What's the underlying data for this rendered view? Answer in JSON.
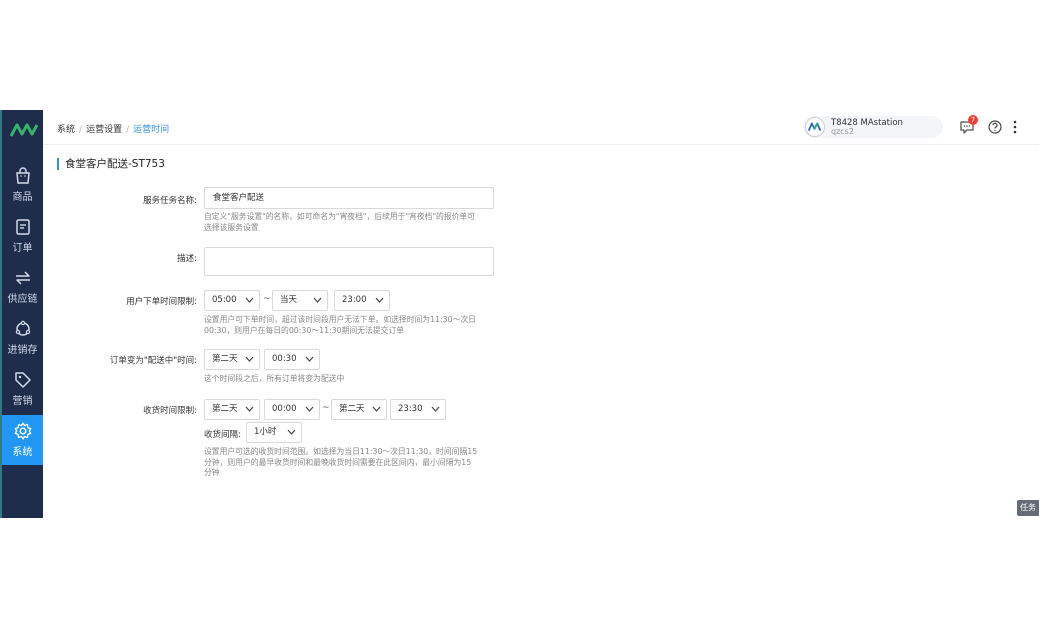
{
  "sidebar": {
    "items": [
      {
        "label": "商品",
        "icon": "shopping-bag-icon"
      },
      {
        "label": "订单",
        "icon": "document-icon"
      },
      {
        "label": "供应链",
        "icon": "swap-arrows-icon"
      },
      {
        "label": "进销存",
        "icon": "cycle-icon"
      },
      {
        "label": "营销",
        "icon": "tag-icon"
      },
      {
        "label": "系统",
        "icon": "gear-icon"
      }
    ],
    "active": "系统",
    "accent": "#2196f3",
    "background": "#1f2d4d"
  },
  "breadcrumb": {
    "items": [
      "系统",
      "运营设置",
      "运营时间"
    ]
  },
  "user": {
    "name": "T8428 MAstation",
    "account": "qzcs2"
  },
  "notifications": {
    "count": "7"
  },
  "section_title": "食堂客户配送-ST753",
  "form": {
    "service_name": {
      "label": "服务任务名称:",
      "value": "食堂客户配送",
      "hint": "自定义\"服务设置\"的名称，如可命名为\"宵夜档\"，后续用于\"宵夜档\"的报价单可",
      "hint2": "选择该服务设置"
    },
    "description": {
      "label": "描述:",
      "value": ""
    },
    "order_time_limit": {
      "label": "用户下单时间限制:",
      "start": "05:00",
      "day": "当天",
      "end": "23:00",
      "sep": "~",
      "hint": "设置用户可下单时间，超过该时间段用户无法下单。如选择时间为11:30～次日",
      "hint2": "00:30，则用户在每日的00:30～11:30期间无法提交订单"
    },
    "delivering_time": {
      "label": "订单变为\"配送中\"时间:",
      "day": "第二天",
      "time": "00:30",
      "hint": "这个时间段之后，所有订单将变为配送中"
    },
    "receive_time_limit": {
      "label": "收货时间限制:",
      "start_day": "第二天",
      "start_time": "00:00",
      "sep": "~",
      "end_day": "第二天",
      "end_time": "23:30",
      "interval_label": "收货间隔:",
      "interval": "1小时",
      "hint": "设置用户可选的收货时间范围。如选择为当日11:30～次日11:30，时间间隔15",
      "hint2": "分钟，则用户的最早收货时间和最晚收货时间需要在此区间内，最小间隔为15",
      "hint3": "分钟"
    }
  },
  "task_tab": "任务"
}
